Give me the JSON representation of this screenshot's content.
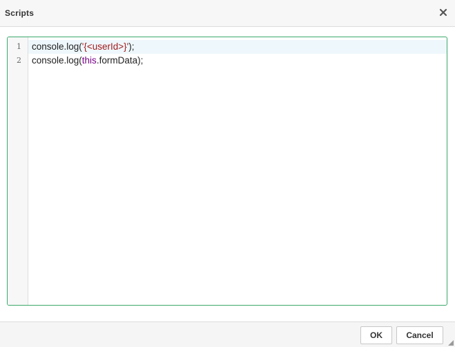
{
  "dialog": {
    "title": "Scripts",
    "close_icon": "close-icon"
  },
  "editor": {
    "lines": [
      {
        "number": "1",
        "tokens": [
          {
            "type": "plain",
            "text": "console.log("
          },
          {
            "type": "string",
            "text": "'{<userId>}'"
          },
          {
            "type": "plain",
            "text": ");"
          }
        ]
      },
      {
        "number": "2",
        "tokens": [
          {
            "type": "plain",
            "text": "console.log("
          },
          {
            "type": "keyword",
            "text": "this"
          },
          {
            "type": "plain",
            "text": ".formData);"
          }
        ]
      }
    ],
    "active_line": 1,
    "colors": {
      "border": "#3aa86a",
      "string": "#a11a1a",
      "keyword": "#770088",
      "active_line_bg": "#eef7fc"
    }
  },
  "footer": {
    "ok_label": "OK",
    "cancel_label": "Cancel"
  }
}
